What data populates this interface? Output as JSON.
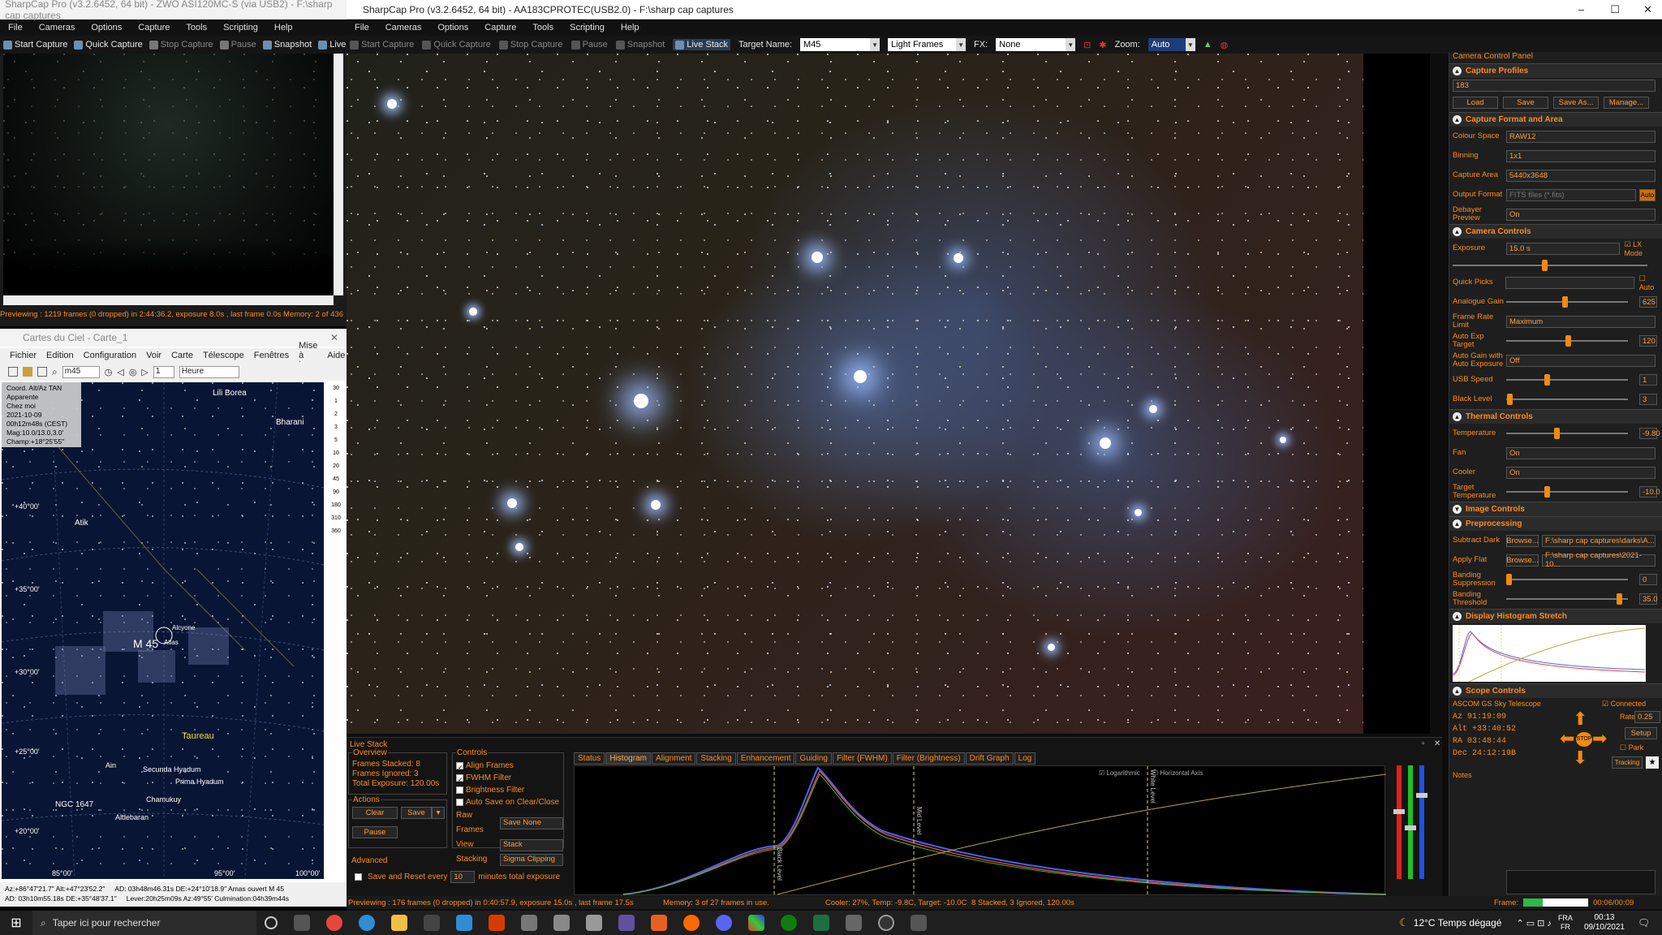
{
  "left_window": {
    "title": "SharpCap Pro (v3.2.6452, 64 bit) - ZWO ASI120MC-S (via USB2) - F:\\sharp cap captures",
    "menu": [
      "File",
      "Cameras",
      "Options",
      "Capture",
      "Tools",
      "Scripting",
      "Help"
    ],
    "toolbar": [
      "Start Capture",
      "Quick Capture",
      "Stop Capture",
      "Pause",
      "Snapshot",
      "Live Stack"
    ],
    "status": "Previewing : 1219 frames (0 dropped) in 2:44:36.2, exposure 8.0s , last frame 0.0s   Memory: 2 of 436"
  },
  "main_window": {
    "title": "SharpCap Pro (v3.2.6452, 64 bit) - AA183CPROTEC(USB2.0) - F:\\sharp cap captures",
    "menu": [
      "File",
      "Cameras",
      "Options",
      "Capture",
      "Tools",
      "Scripting",
      "Help"
    ],
    "toolbar": {
      "start": "Start Capture",
      "quick": "Quick Capture",
      "stop": "Stop Capture",
      "pause": "Pause",
      "snapshot": "Snapshot",
      "live": "Live Stack",
      "target_label": "Target Name:",
      "target_value": "M45",
      "frames_value": "Light Frames",
      "fx_label": "FX:",
      "fx_value": "None",
      "zoom_label": "Zoom:",
      "zoom_value": "Auto"
    },
    "controls": {
      "minimize": "–",
      "maximize": "☐",
      "close": "✕"
    },
    "status": {
      "preview": "Previewing : 176 frames (0 dropped) in 0:40:57.9, exposure 15.0s , last frame 17.5s",
      "memory": "Memory: 3 of 27 frames in use.",
      "cooler": "Cooler: 27%, Temp: -9.8C, Target: -10.0C",
      "stack": "8 Stacked, 3 Ignored, 120.00s",
      "frame_label": "Frame:",
      "frame_time": "00:06/00:09"
    }
  },
  "camera_panel": {
    "title": "Camera Control Panel",
    "capture_profiles": {
      "header": "Capture Profiles",
      "value": "183",
      "buttons": [
        "Load",
        "Save",
        "Save As...",
        "Manage..."
      ]
    },
    "format": {
      "header": "Capture Format and Area",
      "rows": [
        [
          "Colour Space",
          "RAW12"
        ],
        [
          "Binning",
          "1x1"
        ],
        [
          "Capture Area",
          "5440x3648"
        ],
        [
          "Output Format",
          "FITS files (*.fits)"
        ],
        [
          "Debayer Preview",
          "On"
        ]
      ],
      "auto": "Auto"
    },
    "camera": {
      "header": "Camera Controls",
      "exposure_label": "Exposure",
      "exposure_value": "15.0 s",
      "lx_mode": "LX Mode",
      "quick_picks": "Quick Picks",
      "auto": "Auto",
      "rows": [
        {
          "label": "Analogue Gain",
          "type": "slider",
          "value": "625",
          "level": 0.48
        },
        {
          "label": "Frame Rate Limit",
          "type": "dd",
          "value": "Maximum"
        },
        {
          "label": "Auto Exp Target",
          "type": "slider",
          "value": "120",
          "level": 0.51
        },
        {
          "label": "Auto Gain with Auto Exposure",
          "type": "dd",
          "value": "Off"
        },
        {
          "label": "USB Speed",
          "type": "slider",
          "value": "1",
          "level": 0.33
        },
        {
          "label": "Black Level",
          "type": "slider",
          "value": "3",
          "level": 0.01
        }
      ]
    },
    "thermal": {
      "header": "Thermal Controls",
      "rows": [
        {
          "label": "Temperature",
          "type": "slider",
          "value": "-9.80",
          "level": 0.41
        },
        {
          "label": "Fan",
          "type": "dd",
          "value": "On"
        },
        {
          "label": "Cooler",
          "type": "dd",
          "value": "On"
        },
        {
          "label": "Target Temperature",
          "type": "slider",
          "value": "-10.0",
          "level": 0.33
        }
      ]
    },
    "image": {
      "header": "Image Controls"
    },
    "preprocessing": {
      "header": "Preprocessing",
      "subtract_dark": "Subtract Dark",
      "apply_flat": "Apply Flat",
      "browse": "Browse...",
      "dark_path": "F:\\sharp cap captures\\darks\\A...",
      "flat_path": "F:\\sharp cap captures\\2021-10...",
      "banding_sup": "Banding Suppression",
      "banding_sup_val": "0",
      "banding_thr": "Banding Threshold",
      "banding_thr_val": "35.0"
    },
    "histogram": {
      "header": "Display Histogram Stretch"
    },
    "scope": {
      "header": "Scope Controls",
      "name": "ASCOM GS Sky Telescope",
      "connected": "Connected",
      "az_label": "Az",
      "az": "91:19:09",
      "alt_label": "Alt",
      "alt": "+33:40:52",
      "ra_label": "RA",
      "ra": "03:48:44",
      "dec_label": "Dec",
      "dec": "24:12:19B",
      "rate_label": "Rate:",
      "rate": "0.25",
      "setup": "Setup",
      "park": "Park",
      "tracking": "Tracking",
      "stop": "STOP",
      "notes": "Notes"
    }
  },
  "live_stack": {
    "title": "Live Stack",
    "overview": "Overview",
    "frames_stacked": "Frames Stacked: 8",
    "frames_ignored": "Frames Ignored: 3",
    "total_exposure": "Total Exposure: 120.00s",
    "actions": "Actions",
    "clear": "Clear",
    "save": "Save",
    "pause": "Pause",
    "controls": "Controls",
    "align": "Align Frames",
    "fwhm": "FWHM Filter",
    "brightness": "Brightness Filter",
    "auto_save": "Auto Save on Clear/Close",
    "raw_label": "Raw Frames",
    "raw_value": "Save None",
    "view_label": "View",
    "view_value": "Stack",
    "stacking_label": "Stacking",
    "stacking_value": "Sigma Clipping",
    "advanced": "Advanced",
    "save_reset": "Save and Reset every",
    "minutes": "10",
    "minutes_suffix": "minutes total exposure",
    "tabs": [
      "Status",
      "Histogram",
      "Alignment",
      "Stacking",
      "Enhancement",
      "Guiding",
      "Filter (FWHM)",
      "Filter (Brightness)",
      "Drift Graph",
      "Log"
    ],
    "hist": {
      "log": "Logarithmic",
      "horiz": "Horizontal Axis",
      "black": "Black Level",
      "mid": "Mid Level",
      "white": "White Level"
    }
  },
  "cdc": {
    "title": "Cartes du Ciel - Carte_1",
    "menu": [
      "Fichier",
      "Edition",
      "Configuration",
      "Voir",
      "Carte",
      "Télescope",
      "Fenêtres",
      "Mise à jour",
      "Aide"
    ],
    "search": "m45",
    "step": "1",
    "unit": "Heure",
    "info": [
      "Coord. Alt/Az TAN",
      "Apparente",
      "Chez moi",
      "2021-10-09",
      "00h12m48s (CEST)",
      "Mag:10.0/13.0,3.0'",
      "Champ:+18°25'55\""
    ],
    "labels": {
      "lili": "Lili Borea",
      "bharani": "Bharani",
      "atik": "Atik",
      "alcyone": "Alcyone",
      "atlas": "Atlas",
      "m45": "M 45",
      "taureau": "Taureau",
      "ain": "Ain",
      "secunda": "Secunda Hyadum",
      "prima": "Prima Hyadum",
      "chamukuy": "Chamukuy",
      "aldebaran": "Aldebaran",
      "ngc": "NGC 1647"
    },
    "decl": [
      "+40°00'",
      "+35°00'",
      "+30°00'",
      "+25°00'",
      "+20°00'"
    ],
    "ticks_bottom": [
      "85°00'",
      "95°00'",
      "100°00'"
    ],
    "scale": [
      "30",
      "1",
      "2",
      "3",
      "5",
      "10",
      "20",
      "45",
      "90",
      "180",
      "310",
      "360"
    ],
    "status1": "Az:+86°47'21.7\" Alt:+47°23'52.2\"",
    "status2": "AD: 03h48m46.31s DE:+24°10'18.9\"   Amas ouvert M 45",
    "status3": "AD: 03h10m55.18s DE:+35°48'37.1\"",
    "status4": "Lever:20h25m09s Az:49°55'  Culmination:04h39m44s"
  },
  "taskbar": {
    "search": "Taper ici pour rechercher",
    "weather": "12°C  Temps dégagé",
    "lang": "FRA",
    "lang2": "FR",
    "time": "00:13",
    "date": "09/10/2021"
  }
}
